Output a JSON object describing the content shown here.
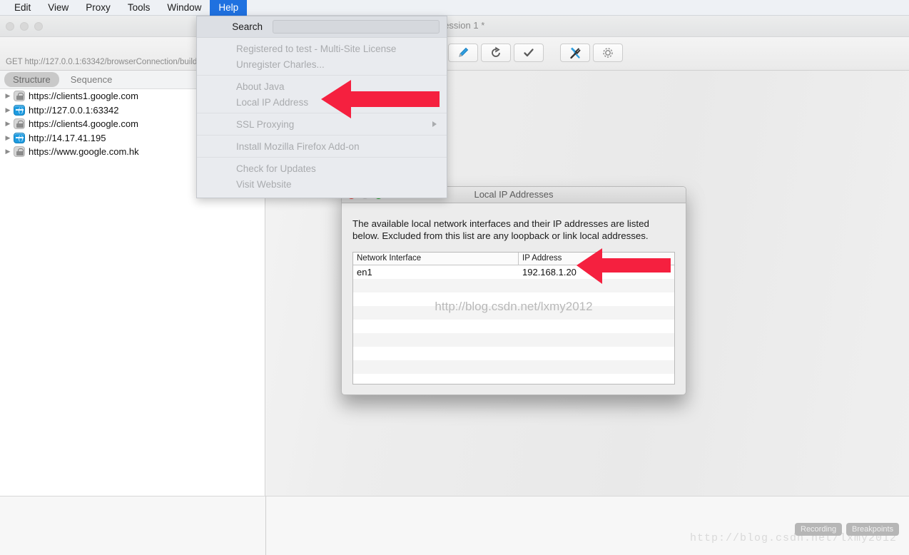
{
  "menubar": {
    "items": [
      {
        "label": "Edit",
        "active": false
      },
      {
        "label": "View",
        "active": false
      },
      {
        "label": "Proxy",
        "active": false
      },
      {
        "label": "Tools",
        "active": false
      },
      {
        "label": "Window",
        "active": false
      },
      {
        "label": "Help",
        "active": true
      }
    ]
  },
  "window": {
    "title": "2 - Session 1 *",
    "toolbar": {
      "buttons": [
        {
          "name": "marker-pen-icon",
          "glyph": "pen"
        },
        {
          "name": "reload-icon",
          "glyph": "reload"
        },
        {
          "name": "checkmark-icon",
          "glyph": "check"
        },
        {
          "name": "tools-icon",
          "glyph": "tools"
        },
        {
          "name": "gear-icon",
          "glyph": "gear"
        }
      ]
    }
  },
  "sidebar": {
    "tabs": [
      {
        "label": "Structure",
        "selected": true
      },
      {
        "label": "Sequence",
        "selected": false
      }
    ],
    "tree": [
      {
        "label": "https://clients1.google.com",
        "icon": "lock-icon"
      },
      {
        "label": "http://127.0.0.1:63342",
        "icon": "globe-icon"
      },
      {
        "label": "https://clients4.google.com",
        "icon": "lock-icon"
      },
      {
        "label": "http://14.17.41.195",
        "icon": "globe-icon"
      },
      {
        "label": "https://www.google.com.hk",
        "icon": "lock-icon"
      }
    ]
  },
  "help_menu": {
    "search_label": "Search",
    "search_value": "",
    "search_placeholder": "",
    "groups": [
      {
        "items": [
          {
            "label": "Registered to test - Multi-Site License",
            "submenu": false
          },
          {
            "label": "Unregister Charles...",
            "submenu": false
          }
        ]
      },
      {
        "items": [
          {
            "label": "About Java",
            "submenu": false
          },
          {
            "label": "Local IP Address",
            "submenu": false
          }
        ]
      },
      {
        "items": [
          {
            "label": "SSL Proxying",
            "submenu": true
          }
        ]
      },
      {
        "items": [
          {
            "label": "Install Mozilla Firefox Add-on",
            "submenu": false
          }
        ]
      },
      {
        "items": [
          {
            "label": "Check for Updates",
            "submenu": false
          },
          {
            "label": "Visit Website",
            "submenu": false
          }
        ]
      }
    ]
  },
  "dialog": {
    "title": "Local IP Addresses",
    "description": "The available local network interfaces and their IP addresses are listed below.  Excluded from this list are any loopback or link local addresses.",
    "table": {
      "headers": [
        "Network Interface",
        "IP Address"
      ],
      "rows": [
        [
          "en1",
          "192.168.1.20"
        ],
        [
          "",
          ""
        ],
        [
          "",
          ""
        ],
        [
          "",
          ""
        ],
        [
          "",
          ""
        ],
        [
          "",
          ""
        ],
        [
          "",
          ""
        ],
        [
          "",
          ""
        ],
        [
          "",
          ""
        ]
      ]
    },
    "watermark": "http://blog.csdn.net/lxmy2012"
  },
  "statusbar": {
    "text": "GET http://127.0.0.1:63342/browserConnection/buildInfo",
    "recording_label": "Recording",
    "breakpoints_label": "Breakpoints"
  },
  "watermark_corner": "http://blog.csdn.net/lxmy2012",
  "colors": {
    "menu_highlight": "#1f71e0",
    "arrow_red": "#f5203f",
    "globe_blue": "#1e9be0",
    "dialog_close": "#ff5f57",
    "dialog_zoom": "#28c940"
  }
}
